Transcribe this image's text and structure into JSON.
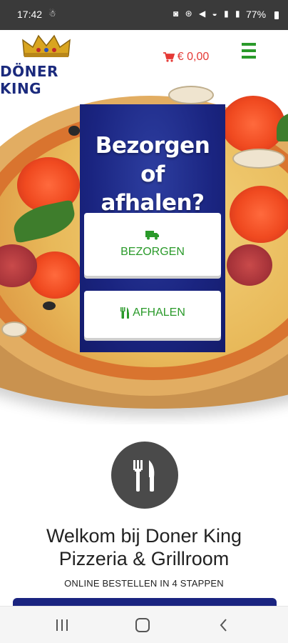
{
  "status_bar": {
    "time": "17:42",
    "left_icon": "☃",
    "system_icons": "◙ ⊛ ◀ ◒ ▮ ▮",
    "battery": "77%"
  },
  "header": {
    "logo_text": "DÖNER KING",
    "cart_amount": "€ 0,00"
  },
  "order_panel": {
    "title_line1": "Bezorgen of",
    "title_line2": "afhalen?",
    "delivery_label": "BEZORGEN",
    "pickup_label": "AFHALEN"
  },
  "welcome": {
    "title_line1": "Welkom bij Doner King",
    "title_line2": "Pizzeria & Grillroom",
    "steps_label": "ONLINE BESTELLEN IN 4 STAPPEN"
  },
  "colors": {
    "brand_blue": "#1a2480",
    "green": "#2a9a2a",
    "cart_red": "#e53935"
  }
}
